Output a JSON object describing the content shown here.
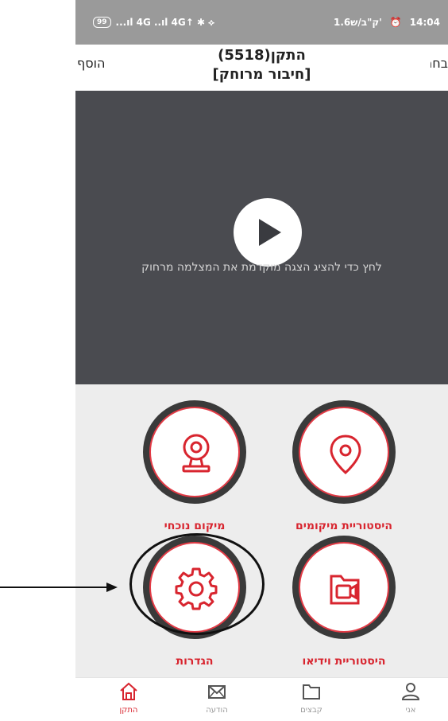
{
  "status_bar": {
    "time": "14:04",
    "network_speed": "1.6ק\"ב/ש'",
    "signals": "...ıl 4G ..ıl 4G↑ ✱ ⟡",
    "battery": "99"
  },
  "header": {
    "title_line1": "התקן(5518)",
    "title_line2": "[חיבור מרוחק]",
    "left_action": "הוסף",
    "right_action": "בחר"
  },
  "video": {
    "hint": "לחץ כדי להציג הצגה מוקדמת את המצלמה מרחוק"
  },
  "tiles": {
    "location_history": "היסטוריית מיקומים",
    "current_location": "מיקום נוכחי",
    "video_history": "היסטוריית וידיאו",
    "settings": "הגדרות"
  },
  "nav": {
    "me": "אני",
    "files": "קבצים",
    "messages": "הודעה",
    "device": "התקן",
    "active": "device"
  },
  "colors": {
    "accent": "#d8252f",
    "video_bg": "#4a4b50",
    "grid_bg": "#ededed",
    "status_bar": "#9a9a9a"
  }
}
